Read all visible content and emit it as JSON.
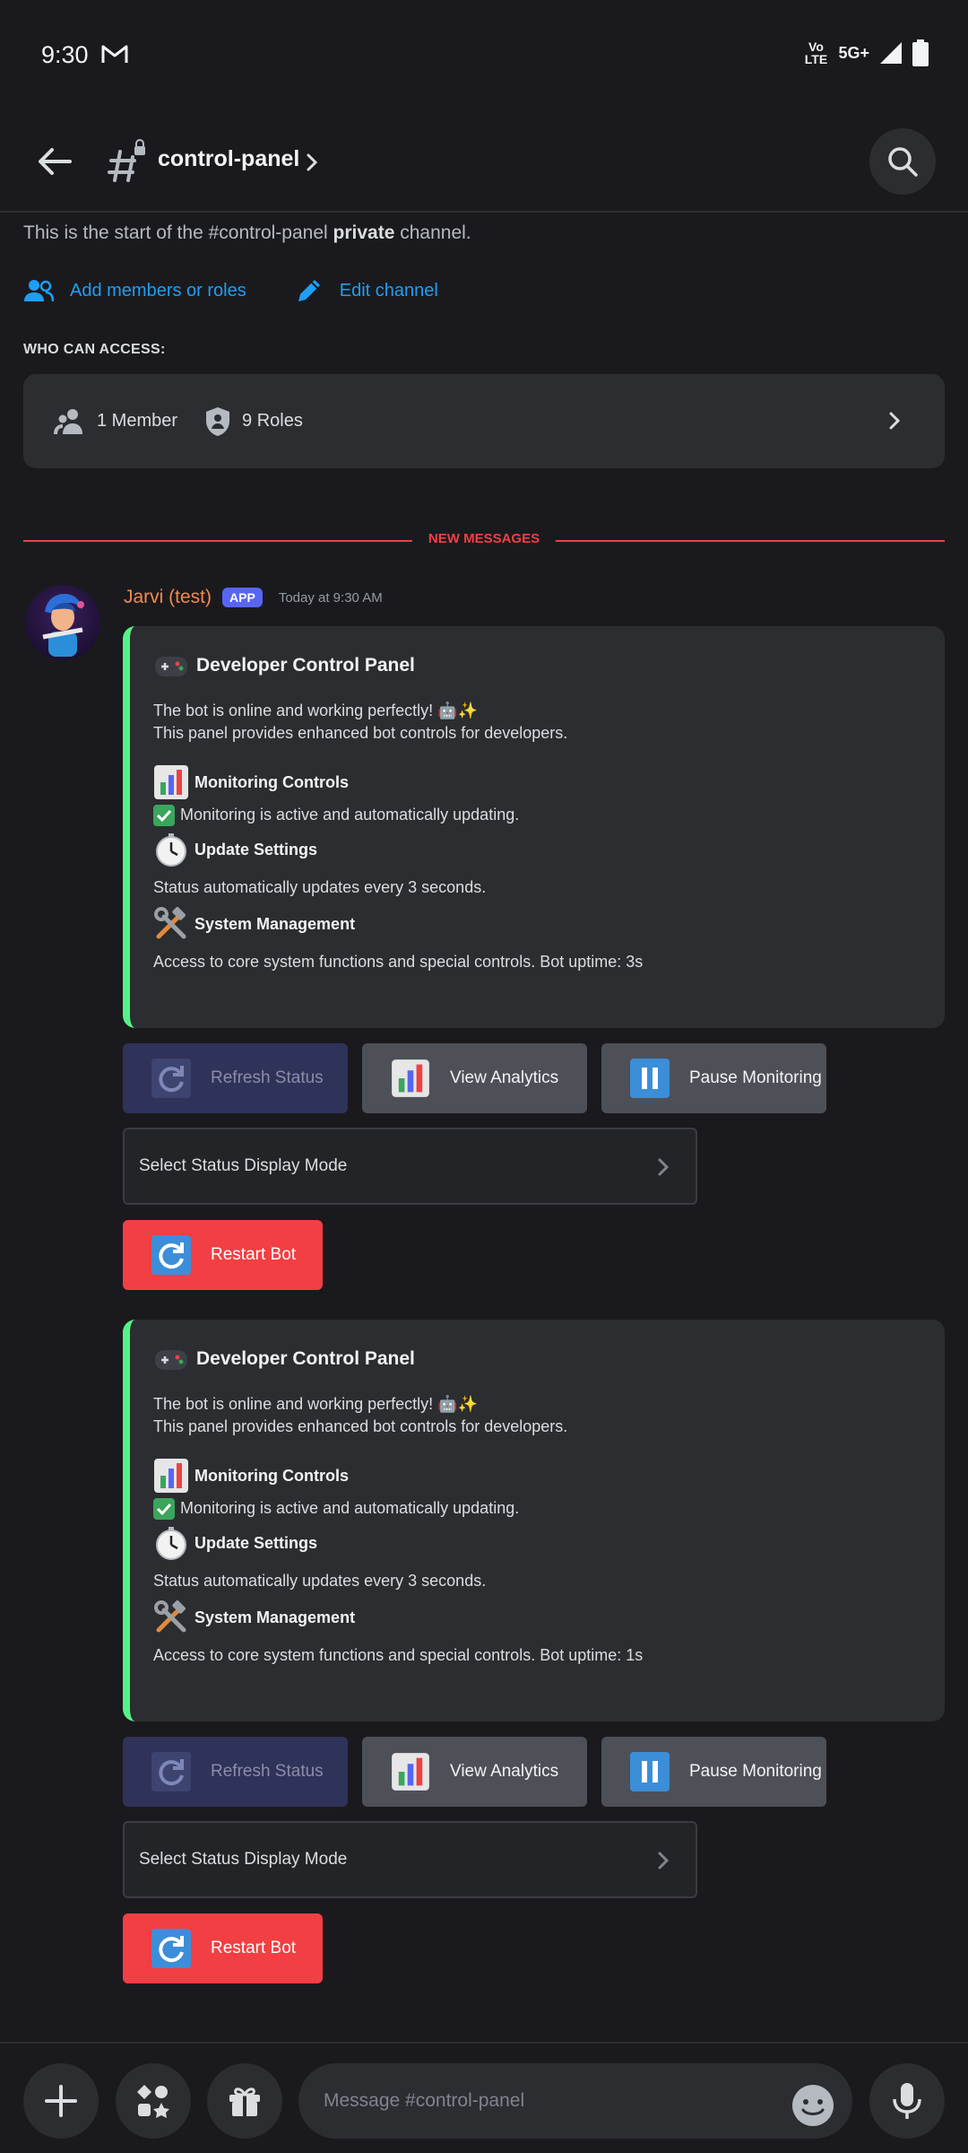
{
  "status_bar": {
    "time": "9:30",
    "volte": "Vo LTE",
    "network": "5G+"
  },
  "header": {
    "channel_name": "control-panel"
  },
  "intro": {
    "text_before": "This is the start of the #control-panel ",
    "text_bold": "private",
    "text_after": " channel."
  },
  "actions": {
    "add_members": "Add members or roles",
    "edit_channel": "Edit channel"
  },
  "access": {
    "heading": "WHO CAN ACCESS:",
    "members": "1 Member",
    "roles": "9 Roles"
  },
  "new_messages_label": "NEW MESSAGES",
  "message": {
    "author": "Jarvi (test)",
    "badge": "APP",
    "timestamp": "Today at 9:30 AM"
  },
  "embeds": [
    {
      "title": "Developer Control Panel",
      "line1": "The bot is online and working perfectly! 🤖✨",
      "line2": "This panel provides enhanced bot controls for developers.",
      "monitoring_title": "Monitoring Controls",
      "monitoring_text": "Monitoring is active and automatically updating.",
      "update_title": "Update Settings",
      "update_text": "Status automatically updates every 3 seconds.",
      "system_title": "System Management",
      "system_text": "Access to core system functions and special controls. Bot uptime: 3s"
    },
    {
      "title": "Developer Control Panel",
      "line1": "The bot is online and working perfectly! 🤖✨",
      "line2": "This panel provides enhanced bot controls for developers.",
      "monitoring_title": "Monitoring Controls",
      "monitoring_text": "Monitoring is active and automatically updating.",
      "update_title": "Update Settings",
      "update_text": "Status automatically updates every 3 seconds.",
      "system_title": "System Management",
      "system_text": "Access to core system functions and special controls. Bot uptime: 1s"
    }
  ],
  "buttons": {
    "refresh": "Refresh Status",
    "analytics": "View Analytics",
    "pause": "Pause Monitoring",
    "select_placeholder": "Select Status Display Mode",
    "restart": "Restart Bot"
  },
  "composer": {
    "placeholder": "Message #control-panel"
  },
  "colors": {
    "accent_link": "#1e9ff5",
    "danger": "#f23f43",
    "embed_border": "#57f287",
    "blurple": "#5865f2"
  }
}
